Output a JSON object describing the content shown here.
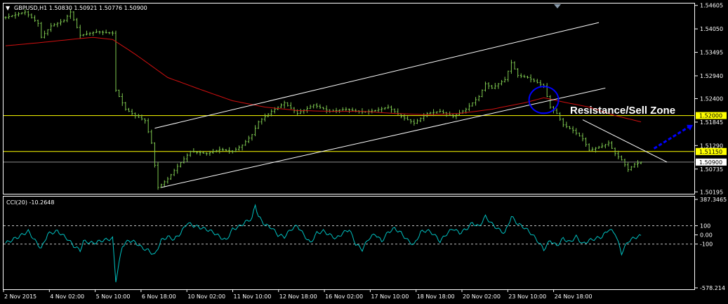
{
  "window": {
    "title": "GBPUSD,H1  1.50830 1.50921 1.50776 1.50900",
    "indicator_title": "CCI(20) -10.2648",
    "annotation": "Resistance/Sell Zone"
  },
  "colors": {
    "background": "#000000",
    "candle": "#7ec850",
    "ma": "#d01010",
    "support_resistance": "#ffff00",
    "trendline": "#ffffff",
    "cci": "#00c0c0",
    "circle": "#0000ff",
    "arrow": "#0000ff"
  },
  "chart_data": [
    {
      "type": "line",
      "title": "GBPUSD,H1",
      "price_axis": {
        "ticks": [
          "1.54605",
          "1.54050",
          "1.53495",
          "1.52940",
          "1.52400",
          "1.51845",
          "1.51290",
          "1.50735",
          "1.50195"
        ],
        "ylim": [
          1.5015,
          1.5465
        ]
      },
      "time_axis": {
        "labels": [
          "2 Nov 2015",
          "4 Nov 02:00",
          "5 Nov 10:00",
          "6 Nov 18:00",
          "10 Nov 02:00",
          "11 Nov 10:00",
          "12 Nov 18:00",
          "16 Nov 02:00",
          "17 Nov 10:00",
          "18 Nov 18:00",
          "20 Nov 02:00",
          "23 Nov 10:00",
          "24 Nov 18:00"
        ],
        "bar_range": [
          0,
          196
        ]
      },
      "price_series": {
        "name": "GBPUSD",
        "keypoints": [
          [
            0,
            1.5432
          ],
          [
            6,
            1.5445
          ],
          [
            10,
            1.5418
          ],
          [
            11,
            1.5385
          ],
          [
            14,
            1.5412
          ],
          [
            18,
            1.5425
          ],
          [
            20,
            1.5445
          ],
          [
            23,
            1.539
          ],
          [
            28,
            1.5398
          ],
          [
            33,
            1.5395
          ],
          [
            34,
            1.526
          ],
          [
            37,
            1.5215
          ],
          [
            40,
            1.52
          ],
          [
            43,
            1.5188
          ],
          [
            45,
            1.5135
          ],
          [
            47,
            1.503
          ],
          [
            50,
            1.505
          ],
          [
            53,
            1.508
          ],
          [
            57,
            1.5115
          ],
          [
            62,
            1.511
          ],
          [
            66,
            1.512
          ],
          [
            70,
            1.5115
          ],
          [
            73,
            1.513
          ],
          [
            76,
            1.5155
          ],
          [
            78,
            1.5185
          ],
          [
            82,
            1.521
          ],
          [
            86,
            1.523
          ],
          [
            90,
            1.5205
          ],
          [
            95,
            1.5225
          ],
          [
            100,
            1.521
          ],
          [
            105,
            1.5215
          ],
          [
            110,
            1.5208
          ],
          [
            114,
            1.5212
          ],
          [
            118,
            1.522
          ],
          [
            122,
            1.5198
          ],
          [
            126,
            1.5182
          ],
          [
            130,
            1.5205
          ],
          [
            134,
            1.521
          ],
          [
            138,
            1.5198
          ],
          [
            142,
            1.5215
          ],
          [
            146,
            1.5245
          ],
          [
            148,
            1.5275
          ],
          [
            150,
            1.5265
          ],
          [
            154,
            1.5285
          ],
          [
            156,
            1.5325
          ],
          [
            158,
            1.5295
          ],
          [
            161,
            1.529
          ],
          [
            164,
            1.5278
          ],
          [
            166,
            1.527
          ],
          [
            168,
            1.522
          ],
          [
            170,
            1.5205
          ],
          [
            172,
            1.5178
          ],
          [
            175,
            1.5165
          ],
          [
            178,
            1.5145
          ],
          [
            180,
            1.5118
          ],
          [
            184,
            1.5128
          ],
          [
            186,
            1.5135
          ],
          [
            188,
            1.511
          ],
          [
            190,
            1.5095
          ],
          [
            192,
            1.5072
          ],
          [
            194,
            1.5085
          ],
          [
            196,
            1.509
          ]
        ]
      },
      "moving_average": {
        "keypoints": [
          [
            0,
            1.5365
          ],
          [
            10,
            1.5372
          ],
          [
            20,
            1.538
          ],
          [
            27,
            1.5385
          ],
          [
            33,
            1.538
          ],
          [
            40,
            1.5345
          ],
          [
            50,
            1.529
          ],
          [
            60,
            1.5262
          ],
          [
            70,
            1.5235
          ],
          [
            80,
            1.522
          ],
          [
            90,
            1.5212
          ],
          [
            100,
            1.521
          ],
          [
            110,
            1.521
          ],
          [
            120,
            1.5205
          ],
          [
            130,
            1.5202
          ],
          [
            140,
            1.5205
          ],
          [
            150,
            1.5215
          ],
          [
            160,
            1.523
          ],
          [
            166,
            1.5242
          ],
          [
            172,
            1.5232
          ],
          [
            180,
            1.522
          ],
          [
            188,
            1.52
          ],
          [
            196,
            1.5185
          ]
        ]
      },
      "horizontal_levels": [
        {
          "value": 1.52,
          "label": "1.52000",
          "style": "yellow"
        },
        {
          "value": 1.5115,
          "label": "1.51150",
          "style": "yellow"
        },
        {
          "value": 1.509,
          "label": "1.50900",
          "style": "current"
        }
      ],
      "trendlines": [
        {
          "from": [
            46,
            1.517
          ],
          "to": [
            183,
            1.542
          ]
        },
        {
          "from": [
            48,
            1.503
          ],
          "to": [
            185,
            1.5265
          ]
        },
        {
          "from": [
            178,
            1.519
          ],
          "to": [
            204,
            1.509
          ]
        }
      ],
      "circle_marker": [
        166,
        1.5237
      ],
      "arrow": {
        "from": [
          200,
          1.5122
        ],
        "to": [
          212,
          1.5178
        ]
      }
    },
    {
      "type": "line",
      "title": "CCI(20)",
      "axis": {
        "ticks": [
          "387.3465",
          "100",
          "0.00",
          "-100",
          "-578.214"
        ],
        "ylim": [
          -578.214,
          387.3465
        ]
      },
      "levels": [
        100,
        -100
      ],
      "series": {
        "name": "CCI(20)",
        "keypoints": [
          [
            0,
            -90
          ],
          [
            4,
            -20
          ],
          [
            7,
            40
          ],
          [
            9,
            -60
          ],
          [
            11,
            -150
          ],
          [
            13,
            10
          ],
          [
            16,
            40
          ],
          [
            19,
            -40
          ],
          [
            21,
            -120
          ],
          [
            23,
            -170
          ],
          [
            24,
            -70
          ],
          [
            27,
            -90
          ],
          [
            30,
            -60
          ],
          [
            33,
            -40
          ],
          [
            34,
            -500
          ],
          [
            36,
            -120
          ],
          [
            38,
            -60
          ],
          [
            40,
            -80
          ],
          [
            42,
            -140
          ],
          [
            44,
            -170
          ],
          [
            46,
            -220
          ],
          [
            48,
            -60
          ],
          [
            50,
            -20
          ],
          [
            52,
            -50
          ],
          [
            54,
            20
          ],
          [
            56,
            130
          ],
          [
            58,
            100
          ],
          [
            60,
            80
          ],
          [
            62,
            60
          ],
          [
            64,
            30
          ],
          [
            66,
            -20
          ],
          [
            68,
            -60
          ],
          [
            70,
            60
          ],
          [
            72,
            90
          ],
          [
            74,
            140
          ],
          [
            76,
            180
          ],
          [
            77,
            330
          ],
          [
            78,
            200
          ],
          [
            80,
            110
          ],
          [
            82,
            80
          ],
          [
            84,
            0
          ],
          [
            86,
            -20
          ],
          [
            88,
            60
          ],
          [
            90,
            100
          ],
          [
            92,
            0
          ],
          [
            94,
            -90
          ],
          [
            96,
            20
          ],
          [
            98,
            40
          ],
          [
            100,
            0
          ],
          [
            102,
            -40
          ],
          [
            104,
            20
          ],
          [
            106,
            60
          ],
          [
            108,
            -100
          ],
          [
            110,
            -160
          ],
          [
            112,
            -40
          ],
          [
            114,
            10
          ],
          [
            116,
            -70
          ],
          [
            118,
            30
          ],
          [
            120,
            70
          ],
          [
            122,
            20
          ],
          [
            124,
            -60
          ],
          [
            126,
            -110
          ],
          [
            128,
            30
          ],
          [
            130,
            50
          ],
          [
            132,
            10
          ],
          [
            134,
            -70
          ],
          [
            136,
            10
          ],
          [
            138,
            70
          ],
          [
            140,
            20
          ],
          [
            142,
            60
          ],
          [
            144,
            130
          ],
          [
            146,
            90
          ],
          [
            148,
            200
          ],
          [
            150,
            120
          ],
          [
            152,
            60
          ],
          [
            154,
            20
          ],
          [
            156,
            200
          ],
          [
            158,
            120
          ],
          [
            160,
            80
          ],
          [
            162,
            20
          ],
          [
            164,
            -60
          ],
          [
            166,
            -160
          ],
          [
            168,
            -60
          ],
          [
            170,
            -120
          ],
          [
            172,
            -40
          ],
          [
            174,
            -80
          ],
          [
            176,
            -20
          ],
          [
            178,
            -100
          ],
          [
            180,
            -60
          ],
          [
            182,
            -40
          ],
          [
            184,
            -20
          ],
          [
            186,
            60
          ],
          [
            188,
            20
          ],
          [
            190,
            -200
          ],
          [
            192,
            -70
          ],
          [
            194,
            -30
          ],
          [
            196,
            -10
          ]
        ]
      }
    }
  ]
}
